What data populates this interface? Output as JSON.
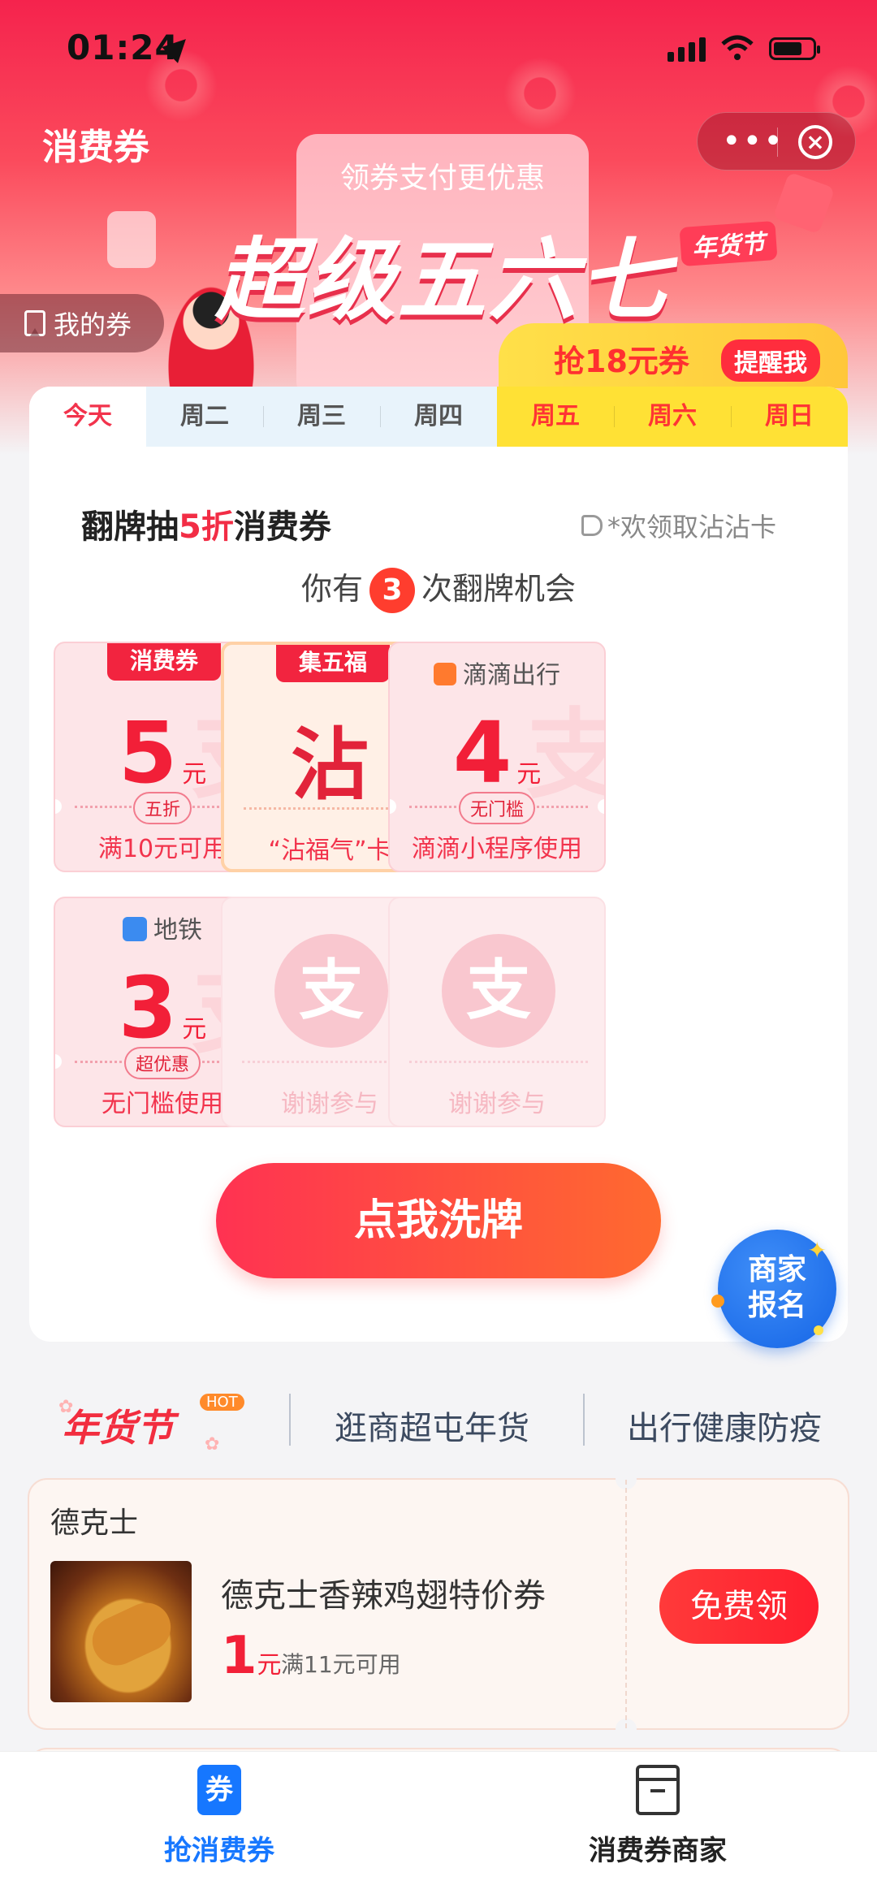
{
  "status_bar": {
    "time": "01:24"
  },
  "header": {
    "title": "消费券",
    "my_coupons": "我的券"
  },
  "banner": {
    "subtitle": "领券支付更优惠",
    "headline": "超级五六七",
    "tag": "年货节",
    "grab_text": "抢18元券",
    "remind_label": "提醒我"
  },
  "day_tabs": [
    "今天",
    "周二",
    "周三",
    "周四",
    "周五",
    "周六",
    "周日"
  ],
  "flip": {
    "title_prefix": "翻牌抽",
    "title_highlight": "5折",
    "title_suffix": "消费券",
    "welcome": "*欢领取沾沾卡",
    "chances_prefix": "你有",
    "chances_count": "3",
    "chances_suffix": "次翻牌机会"
  },
  "cards": [
    {
      "ribbon": "消费券",
      "amount": "5",
      "unit": "元",
      "pill": "五折",
      "bottom": "满10元可用"
    },
    {
      "ribbon": "集五福",
      "char": "沾",
      "bottom": "“沾福气”卡"
    },
    {
      "brand": "滴滴出行",
      "amount": "4",
      "unit": "元",
      "pill": "无门槛",
      "bottom": "滴滴小程序使用"
    },
    {
      "brand": "地铁",
      "amount": "3",
      "unit": "元",
      "pill": "超优惠",
      "bottom": "无门槛使用"
    },
    {
      "symbol": "支",
      "bottom": "谢谢参与"
    },
    {
      "symbol": "支",
      "bottom": "谢谢参与"
    }
  ],
  "watermark": "支",
  "shuffle_label": "点我洗牌",
  "merchant_bubble": {
    "line1": "商家",
    "line2": "报名"
  },
  "categories": {
    "festival": "年货节",
    "hot": "HOT",
    "items": [
      "逛商超屯年货",
      "出行健康防疫"
    ]
  },
  "coupon": {
    "shop": "德克士",
    "name": "德克士香辣鸡翅特价券",
    "price": "1",
    "unit": "元",
    "condition": "满11元可用",
    "claim": "免费领"
  },
  "tabbar": [
    {
      "label": "抢消费券",
      "icon": "券",
      "active": true
    },
    {
      "label": "消费券商家",
      "active": false
    }
  ],
  "colors": {
    "brand_red": "#f22d45",
    "blue": "#1677ff",
    "yellow": "#ffe135"
  }
}
